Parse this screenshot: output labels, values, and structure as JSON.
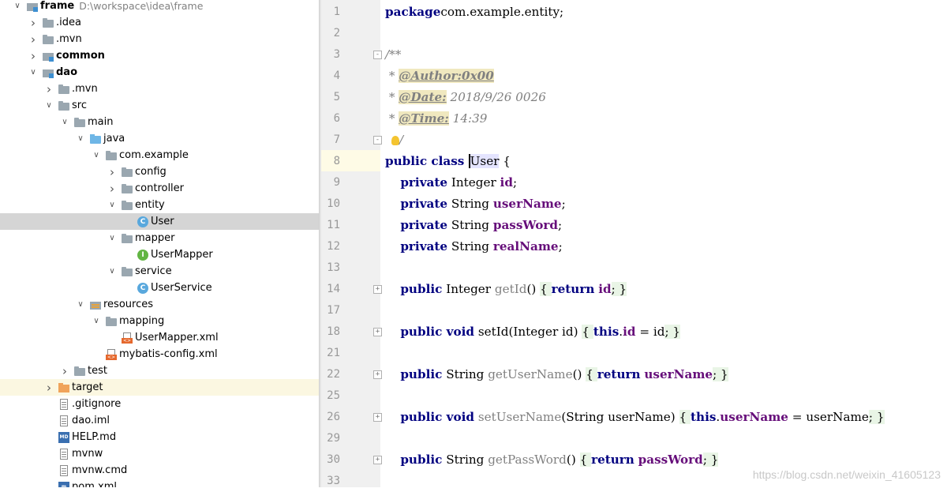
{
  "project": {
    "root_name": "frame",
    "root_path": "D:\\workspace\\idea\\frame"
  },
  "tree": [
    {
      "label": "frame",
      "icon": "module-folder-icon",
      "depth": 0,
      "arrow": "down",
      "bold": true,
      "path": "D:\\workspace\\idea\\frame"
    },
    {
      "label": ".idea",
      "icon": "folder-icon",
      "depth": 1,
      "arrow": "right"
    },
    {
      "label": ".mvn",
      "icon": "folder-icon",
      "depth": 1,
      "arrow": "right"
    },
    {
      "label": "common",
      "icon": "module-folder-icon",
      "depth": 1,
      "arrow": "right",
      "bold": true
    },
    {
      "label": "dao",
      "icon": "module-folder-icon",
      "depth": 1,
      "arrow": "down",
      "bold": true
    },
    {
      "label": ".mvn",
      "icon": "folder-icon",
      "depth": 2,
      "arrow": "right"
    },
    {
      "label": "src",
      "icon": "folder-icon",
      "depth": 2,
      "arrow": "down"
    },
    {
      "label": "main",
      "icon": "folder-icon",
      "depth": 3,
      "arrow": "down"
    },
    {
      "label": "java",
      "icon": "source-folder-icon",
      "depth": 4,
      "arrow": "down"
    },
    {
      "label": "com.example",
      "icon": "folder-icon",
      "depth": 5,
      "arrow": "down"
    },
    {
      "label": "config",
      "icon": "folder-icon",
      "depth": 6,
      "arrow": "right"
    },
    {
      "label": "controller",
      "icon": "folder-icon",
      "depth": 6,
      "arrow": "right"
    },
    {
      "label": "entity",
      "icon": "folder-icon",
      "depth": 6,
      "arrow": "down"
    },
    {
      "label": "User",
      "icon": "class-icon",
      "depth": 7,
      "arrow": "none",
      "selected": true
    },
    {
      "label": "mapper",
      "icon": "folder-icon",
      "depth": 6,
      "arrow": "down"
    },
    {
      "label": "UserMapper",
      "icon": "interface-icon",
      "depth": 7,
      "arrow": "none"
    },
    {
      "label": "service",
      "icon": "folder-icon",
      "depth": 6,
      "arrow": "down"
    },
    {
      "label": "UserService",
      "icon": "class-icon",
      "depth": 7,
      "arrow": "none"
    },
    {
      "label": "resources",
      "icon": "resources-folder-icon",
      "depth": 4,
      "arrow": "down"
    },
    {
      "label": "mapping",
      "icon": "folder-icon",
      "depth": 5,
      "arrow": "down"
    },
    {
      "label": "UserMapper.xml",
      "icon": "xml-file-icon",
      "depth": 6,
      "arrow": "none"
    },
    {
      "label": "mybatis-config.xml",
      "icon": "xml-file-icon",
      "depth": 5,
      "arrow": "none"
    },
    {
      "label": "test",
      "icon": "folder-icon",
      "depth": 3,
      "arrow": "right"
    },
    {
      "label": "target",
      "icon": "excluded-folder-icon",
      "depth": 2,
      "arrow": "right",
      "excluded": true
    },
    {
      "label": ".gitignore",
      "icon": "text-file-icon",
      "depth": 2,
      "arrow": "none"
    },
    {
      "label": "dao.iml",
      "icon": "text-file-icon",
      "depth": 2,
      "arrow": "none"
    },
    {
      "label": "HELP.md",
      "icon": "markdown-file-icon",
      "depth": 2,
      "arrow": "none"
    },
    {
      "label": "mvnw",
      "icon": "text-file-icon",
      "depth": 2,
      "arrow": "none"
    },
    {
      "label": "mvnw.cmd",
      "icon": "text-file-icon",
      "depth": 2,
      "arrow": "none"
    },
    {
      "label": "pom.xml",
      "icon": "maven-file-icon",
      "depth": 2,
      "arrow": "none"
    }
  ],
  "editor": {
    "lines": [
      {
        "num": "1",
        "fold": "",
        "tokens": [
          [
            "kw",
            "package"
          ],
          [
            "",
            "com.example.entity;"
          ]
        ]
      },
      {
        "num": "2",
        "fold": "",
        "tokens": []
      },
      {
        "num": "3",
        "fold": "-",
        "tokens": [
          [
            "cm",
            "/**"
          ]
        ]
      },
      {
        "num": "4",
        "fold": "",
        "tokens": [
          [
            "cm",
            " * "
          ],
          [
            "tag",
            "@Author:0x00"
          ]
        ]
      },
      {
        "num": "5",
        "fold": "",
        "tokens": [
          [
            "cm",
            " * "
          ],
          [
            "tag",
            "@Date:"
          ],
          [
            "cm",
            " 2018/9/26 0026"
          ]
        ]
      },
      {
        "num": "6",
        "fold": "",
        "tokens": [
          [
            "cm",
            " * "
          ],
          [
            "tag",
            "@Time:"
          ],
          [
            "cm",
            " 14:39"
          ]
        ]
      },
      {
        "num": "7",
        "fold": "-",
        "tokens": [
          [
            "bulb",
            ""
          ],
          [
            "cm",
            "/"
          ]
        ]
      },
      {
        "num": "8",
        "fold": "",
        "current": true,
        "tokens": [
          [
            "kw",
            "public class "
          ],
          [
            "caret",
            "User"
          ],
          [
            "",
            " {"
          ]
        ]
      },
      {
        "num": "9",
        "fold": "",
        "tokens": [
          [
            "",
            "    "
          ],
          [
            "kw",
            "private"
          ],
          [
            "",
            " Integer "
          ],
          [
            "fld",
            "id"
          ],
          [
            "",
            ";"
          ]
        ]
      },
      {
        "num": "10",
        "fold": "",
        "tokens": [
          [
            "",
            "    "
          ],
          [
            "kw",
            "private"
          ],
          [
            "",
            " String "
          ],
          [
            "fld",
            "userName"
          ],
          [
            "",
            ";"
          ]
        ]
      },
      {
        "num": "11",
        "fold": "",
        "tokens": [
          [
            "",
            "    "
          ],
          [
            "kw",
            "private"
          ],
          [
            "",
            " String "
          ],
          [
            "fld",
            "passWord"
          ],
          [
            "",
            ";"
          ]
        ]
      },
      {
        "num": "12",
        "fold": "",
        "tokens": [
          [
            "",
            "    "
          ],
          [
            "kw",
            "private"
          ],
          [
            "",
            " String "
          ],
          [
            "fld",
            "realName"
          ],
          [
            "",
            ";"
          ]
        ]
      },
      {
        "num": "13",
        "fold": "",
        "tokens": []
      },
      {
        "num": "14",
        "fold": "+",
        "tokens": [
          [
            "",
            "    "
          ],
          [
            "kw",
            "public"
          ],
          [
            "",
            " Integer "
          ],
          [
            "unused",
            "getId"
          ],
          [
            "",
            "() "
          ],
          [
            "folded",
            "{ "
          ],
          [
            "kw",
            "return"
          ],
          [
            "",
            " "
          ],
          [
            "fld",
            "id"
          ],
          [
            "folded",
            "; }"
          ]
        ]
      },
      {
        "num": "17",
        "fold": "",
        "tokens": []
      },
      {
        "num": "18",
        "fold": "+",
        "tokens": [
          [
            "",
            "    "
          ],
          [
            "kw",
            "public void"
          ],
          [
            "",
            " setId(Integer id) "
          ],
          [
            "folded",
            "{ "
          ],
          [
            "kw",
            "this"
          ],
          [
            "",
            "."
          ],
          [
            "fld",
            "id"
          ],
          [
            "",
            " = id"
          ],
          [
            "folded",
            "; }"
          ]
        ]
      },
      {
        "num": "21",
        "fold": "",
        "tokens": []
      },
      {
        "num": "22",
        "fold": "+",
        "tokens": [
          [
            "",
            "    "
          ],
          [
            "kw",
            "public"
          ],
          [
            "",
            " String "
          ],
          [
            "unused",
            "getUserName"
          ],
          [
            "",
            "() "
          ],
          [
            "folded",
            "{ "
          ],
          [
            "kw",
            "return"
          ],
          [
            "",
            " "
          ],
          [
            "fld",
            "userName"
          ],
          [
            "folded",
            "; }"
          ]
        ]
      },
      {
        "num": "25",
        "fold": "",
        "tokens": []
      },
      {
        "num": "26",
        "fold": "+",
        "tokens": [
          [
            "",
            "    "
          ],
          [
            "kw",
            "public void"
          ],
          [
            "",
            " "
          ],
          [
            "unused",
            "setUserName"
          ],
          [
            "",
            "(String userName) "
          ],
          [
            "folded",
            "{ "
          ],
          [
            "kw",
            "this"
          ],
          [
            "",
            "."
          ],
          [
            "fld",
            "userName"
          ],
          [
            "",
            " = userName"
          ],
          [
            "folded",
            "; }"
          ]
        ]
      },
      {
        "num": "29",
        "fold": "",
        "tokens": []
      },
      {
        "num": "30",
        "fold": "+",
        "tokens": [
          [
            "",
            "    "
          ],
          [
            "kw",
            "public"
          ],
          [
            "",
            " String "
          ],
          [
            "unused",
            "getPassWord"
          ],
          [
            "",
            "() "
          ],
          [
            "folded",
            "{ "
          ],
          [
            "kw",
            "return"
          ],
          [
            "",
            " "
          ],
          [
            "fld",
            "passWord"
          ],
          [
            "folded",
            "; }"
          ]
        ]
      },
      {
        "num": "33",
        "fold": "",
        "tokens": []
      }
    ]
  },
  "watermark": "https://blog.csdn.net/weixin_41605123"
}
